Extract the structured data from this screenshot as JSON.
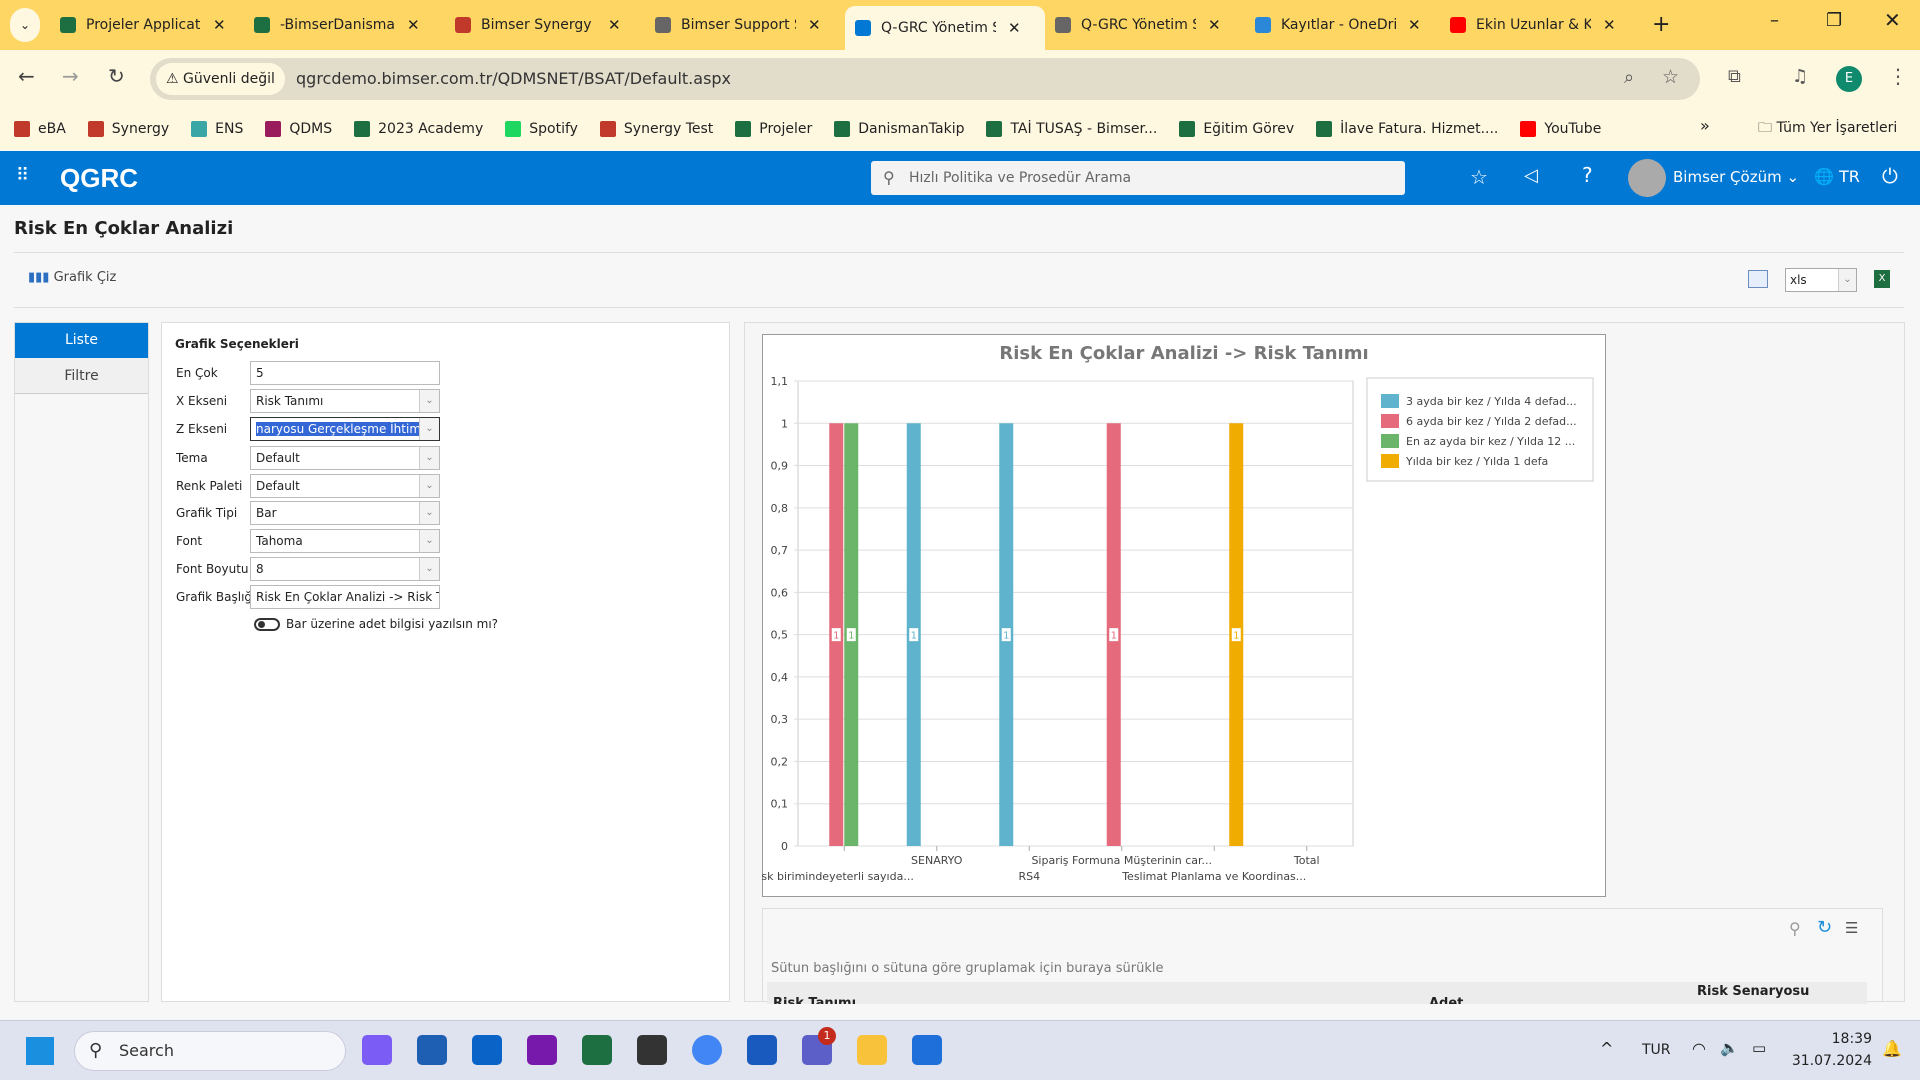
{
  "browser": {
    "tabs": [
      {
        "title": "Projeler Applicati",
        "color": "#1d6f42",
        "active": false
      },
      {
        "title": "-BimserDanisman",
        "color": "#1d6f42",
        "active": false
      },
      {
        "title": "Bimser Synergy",
        "color": "#c0392b",
        "active": false
      },
      {
        "title": "Bimser Support S",
        "color": "#666666",
        "active": false
      },
      {
        "title": "Q-GRC Yönetim S",
        "color": "#0078d4",
        "active": true
      },
      {
        "title": "Q-GRC Yönetim S",
        "color": "#666666",
        "active": false
      },
      {
        "title": "Kayıtlar - OneDri",
        "color": "#2b88d8",
        "active": false
      },
      {
        "title": "Ekin Uzunlar & K",
        "color": "#ff0000",
        "active": false
      }
    ],
    "security_label": "Güvenli değil",
    "url": "qgrcdemo.bimser.com.tr/QDMSNET/BSAT/Default.aspx",
    "profile_initial": "E",
    "bookmarks": [
      {
        "label": "eBA",
        "color": "#c0392b"
      },
      {
        "label": "Synergy",
        "color": "#c0392b"
      },
      {
        "label": "ENS",
        "color": "#3aa6a6"
      },
      {
        "label": "QDMS",
        "color": "#9b1c5c"
      },
      {
        "label": "2023 Academy",
        "color": "#1d6f42"
      },
      {
        "label": "Spotify",
        "color": "#1ed760"
      },
      {
        "label": "Synergy Test",
        "color": "#c0392b"
      },
      {
        "label": "Projeler",
        "color": "#1d6f42"
      },
      {
        "label": "DanismanTakip",
        "color": "#1d6f42"
      },
      {
        "label": "TAİ TUSAŞ - Bimser...",
        "color": "#1d6f42"
      },
      {
        "label": "Eğitim Görev",
        "color": "#1d6f42"
      },
      {
        "label": "İlave Fatura. Hizmet....",
        "color": "#1d6f42"
      },
      {
        "label": "YouTube",
        "color": "#ff0000"
      }
    ],
    "all_bookmarks": "Tüm Yer İşaretleri"
  },
  "app": {
    "logo": "QGRC",
    "search_placeholder": "Hızlı Politika ve Prosedür Arama",
    "user": "Bimser Çözüm",
    "language": "TR",
    "accent": "#0078d4"
  },
  "page": {
    "title": "Risk En Çoklar Analizi",
    "draw_chart": "Grafik Çiz",
    "export_format": "xls",
    "side_tabs": [
      "Liste",
      "Filtre"
    ],
    "options": {
      "heading": "Grafik Seçenekleri",
      "fields": [
        {
          "label": "En Çok",
          "value": "5",
          "type": "text"
        },
        {
          "label": "X Ekseni",
          "value": "Risk Tanımı",
          "type": "select"
        },
        {
          "label": "Z Ekseni",
          "value": "naryosu Gerçekleşme İhtimali",
          "type": "select",
          "focused": true
        },
        {
          "label": "Tema",
          "value": "Default",
          "type": "select"
        },
        {
          "label": "Renk Paleti",
          "value": "Default",
          "type": "select"
        },
        {
          "label": "Grafik Tipi",
          "value": "Bar",
          "type": "select"
        },
        {
          "label": "Font",
          "value": "Tahoma",
          "type": "select"
        },
        {
          "label": "Font Boyutu",
          "value": "8",
          "type": "select"
        },
        {
          "label": "Grafik Başlığı",
          "value": "Risk En Çoklar Analizi -> Risk Tan",
          "type": "text"
        }
      ],
      "toggle_label": "Bar üzerine adet bilgisi yazılsın mı?",
      "toggle_on": false
    },
    "grid": {
      "group_hint": "Sütun başlığını o sütuna göre gruplamak için buraya sürükle",
      "columns": [
        "Risk Tanımı",
        "Adet",
        "Risk Senaryosu"
      ]
    }
  },
  "chart_data": {
    "type": "bar",
    "title": "Risk En Çoklar Analizi -> Risk Tanımı",
    "categories": [
      "Risk birimindeyeterli sayıda...",
      "SENARYO",
      "RS4",
      "Sipariş Formuna Müşterinin car...",
      "Teslimat Planlama ve Koordinas...",
      "Total"
    ],
    "series": [
      {
        "name": "3 ayda bir kez / Yılda 4 defad...",
        "color": "#5fb3cc",
        "values": [
          0,
          1,
          1,
          0,
          0,
          0
        ]
      },
      {
        "name": "6 ayda bir kez / Yılda 2 defad...",
        "color": "#e56a7c",
        "values": [
          1,
          0,
          0,
          1,
          0,
          0
        ]
      },
      {
        "name": "En az ayda bir kez / Yılda 12 ...",
        "color": "#6bb56b",
        "values": [
          1,
          0,
          0,
          0,
          0,
          0
        ]
      },
      {
        "name": "Yılda bir kez / Yılda 1 defa",
        "color": "#f0ac00",
        "values": [
          0,
          0,
          0,
          0,
          1,
          0
        ]
      }
    ],
    "ylim": [
      0,
      1.1
    ],
    "yticks": [
      "0",
      "0,1",
      "0,2",
      "0,3",
      "0,4",
      "0,5",
      "0,6",
      "0,7",
      "0,8",
      "0,9",
      "1",
      "1,1"
    ],
    "grid": true,
    "legend": "top-right",
    "data_labels": true
  },
  "taskbar": {
    "search": "Search",
    "apps": [
      {
        "name": "copilot",
        "color": "#7b5cf5"
      },
      {
        "name": "widgets",
        "color": "#1e5fb4"
      },
      {
        "name": "outlook",
        "color": "#0a64c8"
      },
      {
        "name": "onenote",
        "color": "#7719aa"
      },
      {
        "name": "excel",
        "color": "#1d6f42"
      },
      {
        "name": "sticky-notes",
        "color": "#333333"
      },
      {
        "name": "chrome",
        "color": "#4285f4"
      },
      {
        "name": "word",
        "color": "#185abd"
      },
      {
        "name": "teams",
        "color": "#5b5fc7"
      },
      {
        "name": "file-explorer",
        "color": "#f8c33a"
      },
      {
        "name": "defender",
        "color": "#1e6fd9"
      }
    ],
    "teams_badge": "1",
    "lang": "TUR",
    "time": "18:39",
    "date": "31.07.2024"
  }
}
